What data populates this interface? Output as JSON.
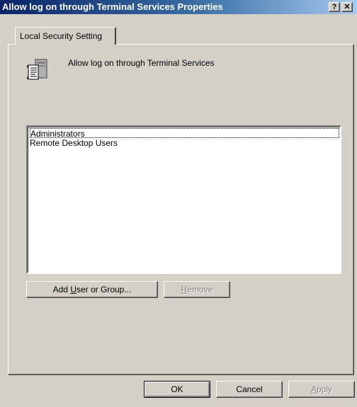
{
  "window": {
    "title": "Allow log on through Terminal Services Properties",
    "help_glyph": "?",
    "close_glyph": "✕"
  },
  "tabs": [
    {
      "label": "Local Security Setting",
      "selected": true
    }
  ],
  "policy": {
    "icon": "policy-document-icon",
    "name": "Allow log on through Terminal Services"
  },
  "members": {
    "items": [
      "Administrators",
      "Remote Desktop Users"
    ],
    "focused_index": 0
  },
  "buttons": {
    "add": {
      "before": "Add ",
      "accel": "U",
      "after": "ser or Group..."
    },
    "remove": {
      "accel": "R",
      "after": "emove",
      "enabled": false
    },
    "ok": "OK",
    "cancel": "Cancel",
    "apply": {
      "accel": "A",
      "after": "pply",
      "enabled": false
    }
  }
}
